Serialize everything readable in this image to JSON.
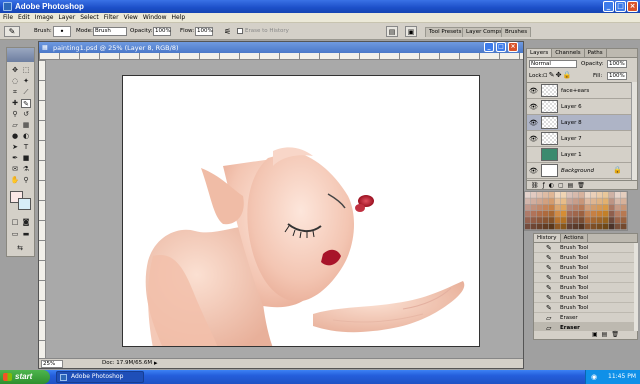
{
  "window": {
    "title": "Adobe Photoshop"
  },
  "menu": [
    "File",
    "Edit",
    "Image",
    "Layer",
    "Select",
    "Filter",
    "View",
    "Window",
    "Help"
  ],
  "options": {
    "brush_label": "Brush:",
    "mode_label": "Mode:",
    "mode_value": "Brush",
    "opacity_label": "Opacity:",
    "opacity_value": "100%",
    "flow_label": "Flow:",
    "flow_value": "100%",
    "erase_history": "Erase to History"
  },
  "palette_well": [
    "Tool Presets",
    "Layer Comps",
    "Brushes"
  ],
  "document": {
    "title": "painting1.psd @ 25% (Layer 8, RGB/8)",
    "zoom": "25%",
    "doc_info": "Doc: 17.9M/65.6M"
  },
  "layers_panel": {
    "tabs": [
      "Layers",
      "Channels",
      "Paths"
    ],
    "blend_mode": "Normal",
    "opacity_label": "Opacity:",
    "opacity_value": "100%",
    "lock_label": "Lock:",
    "fill_label": "Fill:",
    "fill_value": "100%",
    "layers": [
      {
        "name": "face+ears"
      },
      {
        "name": "Layer 6"
      },
      {
        "name": "Layer 8"
      },
      {
        "name": "Layer 7"
      },
      {
        "name": "Layer 1"
      },
      {
        "name": "Background"
      }
    ]
  },
  "history_panel": {
    "tabs": [
      "History",
      "Actions"
    ],
    "items": [
      "Brush Tool",
      "Brush Tool",
      "Brush Tool",
      "Brush Tool",
      "Brush Tool",
      "Brush Tool",
      "Brush Tool",
      "Eraser",
      "Eraser"
    ]
  },
  "taskbar": {
    "start": "start",
    "task": "Adobe Photoshop",
    "clock": "11:45 PM"
  }
}
